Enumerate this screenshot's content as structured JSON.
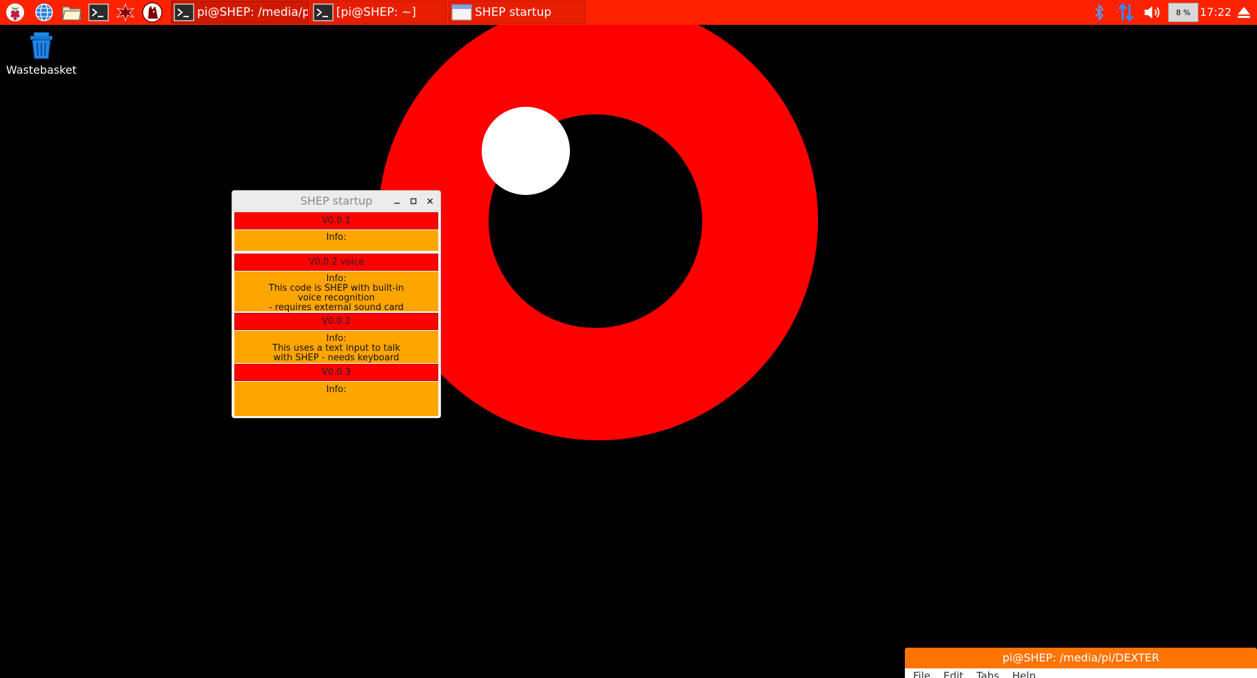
{
  "taskbar": {
    "launchers": [
      {
        "name": "raspberry-menu",
        "icon": "raspberry-icon"
      },
      {
        "name": "web-browser",
        "icon": "globe-icon"
      },
      {
        "name": "file-manager",
        "icon": "folder-icon"
      },
      {
        "name": "terminal",
        "icon": "terminal-icon"
      },
      {
        "name": "mathematica",
        "icon": "star-burst-icon"
      },
      {
        "name": "wolfram",
        "icon": "wolf-icon"
      }
    ],
    "windows": [
      {
        "label": "pi@SHEP: /media/pi...",
        "icon": "terminal-icon",
        "active": true
      },
      {
        "label": "[pi@SHEP: ~]",
        "icon": "terminal-icon",
        "active": false
      },
      {
        "label": "SHEP startup",
        "icon": "window-icon",
        "active": false
      }
    ],
    "tray": {
      "bluetooth_icon": "bluetooth-icon",
      "network_icon": "network-arrows-icon",
      "volume_icon": "volume-icon",
      "cpu_usage": "8 %",
      "clock": "17:22",
      "eject_icon": "eject-icon"
    }
  },
  "desktop": {
    "wastebasket_label": "Wastebasket"
  },
  "dialog": {
    "title": "SHEP startup",
    "versions": [
      {
        "label": "V0.0.1",
        "info": [
          "Info:",
          ""
        ]
      },
      {
        "label": "V0.0.2 voice",
        "info": [
          "Info:",
          "This code is SHEP with built-in",
          "voice recognition",
          "- requires external sound card"
        ]
      },
      {
        "label": "V0.0.2",
        "info": [
          "Info:",
          "This uses a text input to talk",
          "with SHEP - needs keyboard"
        ]
      },
      {
        "label": "V0.0.3",
        "info": [
          "Info:"
        ]
      }
    ]
  },
  "terminal_window": {
    "title": "pi@SHEP: /media/pi/DEXTER",
    "menu": [
      "File",
      "Edit",
      "Tabs",
      "Help"
    ]
  },
  "colors": {
    "taskbar": "#ff2200",
    "eye_ring": "#ff0000",
    "dialog_red": "#ff0000",
    "dialog_orange": "#ffa500",
    "terminal_title": "#ff7300"
  }
}
